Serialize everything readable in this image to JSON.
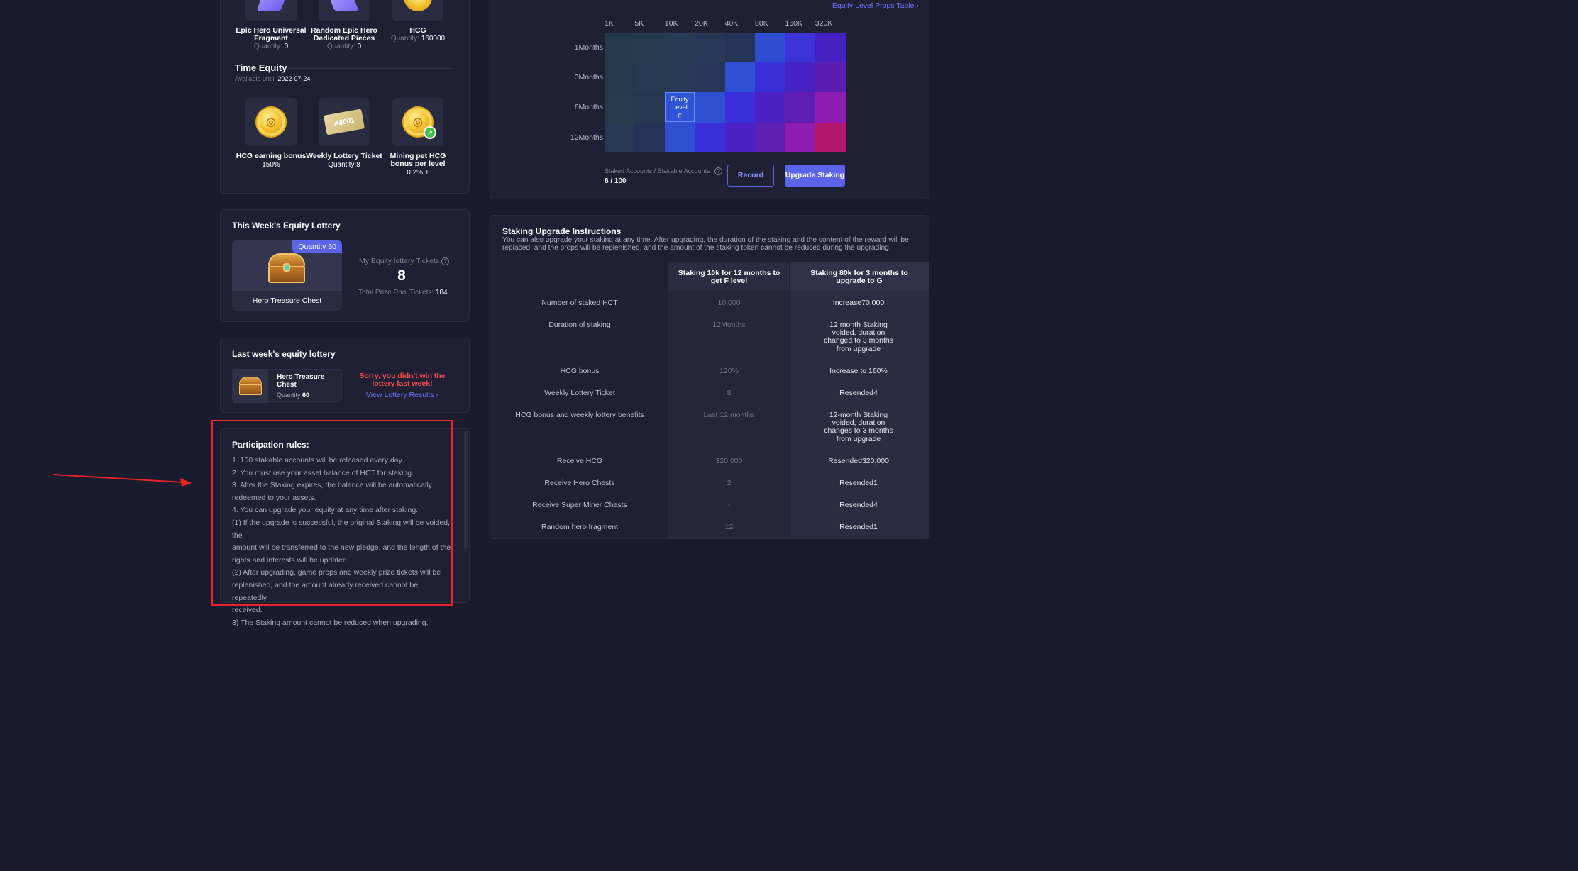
{
  "reward_items": [
    {
      "title": "Epic Hero Universal Fragment",
      "qty_label": "Quantity:",
      "qty": "0"
    },
    {
      "title": "Random Epic Hero Dedicated Pieces",
      "qty_label": "Quantity:",
      "qty": "0"
    },
    {
      "title": "HCG",
      "qty_label": "Quantity:",
      "qty": "160000"
    }
  ],
  "time_equity": {
    "title": "Time Equity",
    "available_label": "Available until:",
    "available_date": "2022-07-24",
    "items": [
      {
        "title": "HCG earning bonus",
        "sub": "150%"
      },
      {
        "title": "Weekly Lottery Ticket",
        "sub": "Quantity:8"
      },
      {
        "title": "Mining pet HCG bonus per level",
        "sub": "0.2% +"
      }
    ],
    "ticket_text": "A8001"
  },
  "this_week": {
    "title": "This Week's Equity Lottery",
    "badge": "Quantity 60",
    "chest_name": "Hero Treasure Chest",
    "my_tickets_label": "My Equity lottery Tickets",
    "my_tickets": "8",
    "pool_label": "Total Prize Pool Tickets:",
    "pool_value": "184"
  },
  "last_week": {
    "title": "Last week's equity lottery",
    "chest_name": "Hero Treasure Chest",
    "qty_label": "Quantity",
    "qty": "60",
    "sorry": "Sorry, you didn't win the lottery last week!",
    "view_results": "View Lottery Results"
  },
  "rules": {
    "title": "Participation rules:",
    "lines": [
      "1. 100 stakable accounts will be released every day.",
      "2. You must use your asset balance of HCT for staking.",
      "3. After the Staking expires, the balance will be automatically",
      "redeemed to your assets.",
      "4. You can upgrade your equity at any time after staking.",
      "(1) If the upgrade is successful, the original Staking will be voided, the",
      "amount will be transferred to the new pledge, and the length of the",
      "rights and interests will be updated.",
      "(2) After upgrading, game props and weekly prize tickets will be",
      "replenished, and the amount already received cannot be repeatedly",
      "received.",
      "3) The Staking amount cannot be reduced when upgrading."
    ]
  },
  "equity_table": {
    "link": "Equity Level Props Table",
    "columns": [
      "1K",
      "5K",
      "10K",
      "20K",
      "40K",
      "80K",
      "160K",
      "320K"
    ],
    "rows": [
      "1Months",
      "3Months",
      "6Months",
      "12Months"
    ],
    "colors": [
      [
        "#243a4c",
        "#253a4c",
        "#263a52",
        "#263855",
        "#243356",
        "#2d4ed0",
        "#3b33d8",
        "#4521c4"
      ],
      [
        "#243a4c",
        "#263a50",
        "#263854",
        "#273558",
        "#2e4fd1",
        "#3a2fd6",
        "#4821c6",
        "#5a1fb0"
      ],
      [
        "#253a4c",
        "#263850",
        "#2f55d6",
        "#2f4fd0",
        "#3a2fd8",
        "#4a22c6",
        "#5e1eb2",
        "#8e1cb4"
      ],
      [
        "#263852",
        "#273356",
        "#2e50d0",
        "#3b30d9",
        "#4b22c6",
        "#5f1fb0",
        "#8e1cb0",
        "#b3176e"
      ]
    ],
    "highlight": {
      "line1": "Equity",
      "line2": "Level",
      "line3": "E"
    },
    "staked_label": "Staked Accounts / Stakable Accounts",
    "staked_value": "8 / 100",
    "record_button": "Record",
    "upgrade_button": "Upgrade Staking"
  },
  "instructions": {
    "title": "Staking Upgrade Instructions",
    "description": "You can also upgrade your staking at any time. After upgrading, the duration of the staking and the content of the reward will be replaced, and the props will be replenished, and the amount of the staking token cannot be reduced during the upgrading.",
    "col1_header": "Staking 10k for 12 months to get F level",
    "col2_header": "Staking 80k for 3 months to upgrade to G",
    "rows": [
      {
        "label": "Number of staked HCT",
        "a": "10,000",
        "b": "Increase70,000"
      },
      {
        "label": "Duration of staking",
        "a": "12Months",
        "b": "12 month Staking voided, duration changed to 3 months from upgrade"
      },
      {
        "label": "HCG bonus",
        "a": "120%",
        "b": "Increase to 160%"
      },
      {
        "label": "Weekly Lottery Ticket",
        "a": "8",
        "b": "Resended4"
      },
      {
        "label": "HCG bonus and weekly lottery benefits",
        "a": "Last 12 months",
        "b": "12-month Staking voided, duration changes to 3 months from upgrade"
      },
      {
        "label": "Receive HCG",
        "a": "320,000",
        "b": "Resended320,000"
      },
      {
        "label": "Receive Hero Chests",
        "a": "2",
        "b": "Resended1"
      },
      {
        "label": "Receive Super Miner Chests",
        "a": "-",
        "b": "Resended4"
      },
      {
        "label": "Random hero fragment",
        "a": "12",
        "b": "Resended1"
      }
    ]
  },
  "colors": {
    "accent": "#5b63e8",
    "link": "#6c74ff",
    "error": "#ff4b4b",
    "annotation_red": "#e8232a"
  }
}
